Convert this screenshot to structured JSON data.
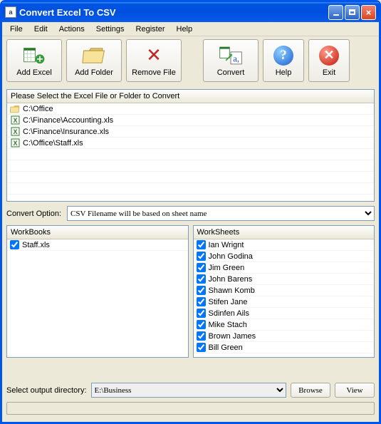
{
  "title": "Convert Excel To CSV",
  "menus": [
    "File",
    "Edit",
    "Actions",
    "Settings",
    "Register",
    "Help"
  ],
  "toolbar": [
    {
      "id": "add-excel",
      "label": "Add Excel"
    },
    {
      "id": "add-folder",
      "label": "Add Folder"
    },
    {
      "id": "remove-file",
      "label": "Remove File"
    },
    {
      "id": "convert",
      "label": "Convert"
    },
    {
      "id": "help",
      "label": "Help"
    },
    {
      "id": "exit",
      "label": "Exit"
    }
  ],
  "filelist_header": "Please Select the Excel File or Folder to Convert",
  "files": [
    {
      "type": "folder",
      "path": "C:\\Office"
    },
    {
      "type": "excel",
      "path": "C:\\Finance\\Accounting.xls"
    },
    {
      "type": "excel",
      "path": "C:\\Finance\\Insurance.xls"
    },
    {
      "type": "excel",
      "path": "C:\\Office\\Staff.xls"
    }
  ],
  "convert_option_label": "Convert Option:",
  "convert_option_value": "CSV Filename will be based on sheet name",
  "workbooks_header": "WorkBooks",
  "workbooks": [
    {
      "name": "Staff.xls",
      "checked": true
    }
  ],
  "worksheets_header": "WorkSheets",
  "worksheets": [
    {
      "name": "Ian Wrignt",
      "checked": true
    },
    {
      "name": "John Godina",
      "checked": true
    },
    {
      "name": "Jim Green",
      "checked": true
    },
    {
      "name": "John Barens",
      "checked": true
    },
    {
      "name": "Shawn Komb",
      "checked": true
    },
    {
      "name": "Stifen Jane",
      "checked": true
    },
    {
      "name": "Sdinfen Ails",
      "checked": true
    },
    {
      "name": "Mike Stach",
      "checked": true
    },
    {
      "name": "Brown James",
      "checked": true
    },
    {
      "name": "Bill Green",
      "checked": true
    }
  ],
  "output_label": "Select  output directory:",
  "output_value": "E:\\Business",
  "browse_label": "Browse",
  "view_label": "View"
}
